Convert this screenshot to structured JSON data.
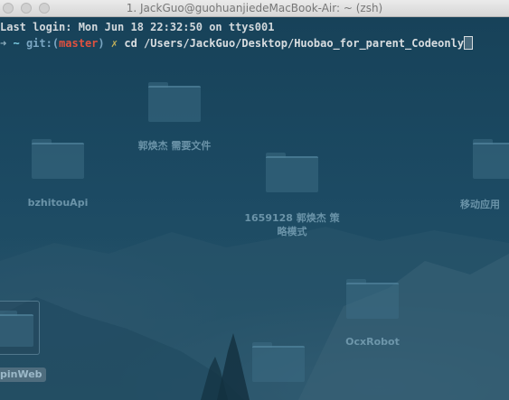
{
  "window": {
    "title": "1. JackGuo@guohuanjiedeMacBook-Air: ~ (zsh)"
  },
  "terminal": {
    "last_login": "Last login: Mon Jun 18 22:32:50 on ttys001",
    "prompt_arrow": "➜",
    "prompt_dir": "~",
    "git_prefix": "git:(",
    "branch": "master",
    "git_suffix": ")",
    "dirty_mark": "✗",
    "command": "cd /Users/JackGuo/Desktop/Huobao_for_parent_Codeonly"
  },
  "desktop_icons": [
    {
      "label": "郭焕杰 需要文件"
    },
    {
      "label": "bzhitouApi"
    },
    {
      "label": "1659128 郭焕杰 策"
    },
    {
      "label": "略模式"
    },
    {
      "label": "移动应用"
    },
    {
      "label": "OcxRobot"
    },
    {
      "label": "pinWeb"
    }
  ]
}
